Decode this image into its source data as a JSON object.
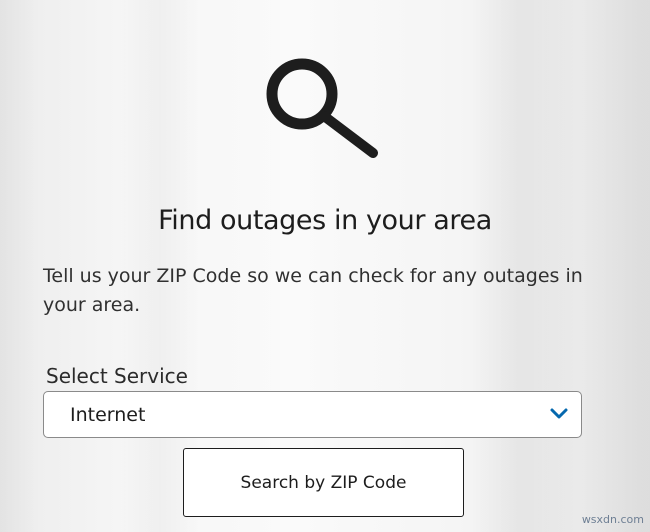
{
  "header": {
    "icon": "search-icon",
    "title": "Find outages in your area"
  },
  "intro": {
    "text": "Tell us your ZIP Code so we can check for any outages in your area."
  },
  "service_select": {
    "label": "Select Service",
    "value": "Internet",
    "icon": "chevron-down-icon",
    "accent_color": "#0568ae"
  },
  "search_button": {
    "label": "Search by ZIP Code"
  },
  "watermark": {
    "text": "wsxdn.com"
  }
}
